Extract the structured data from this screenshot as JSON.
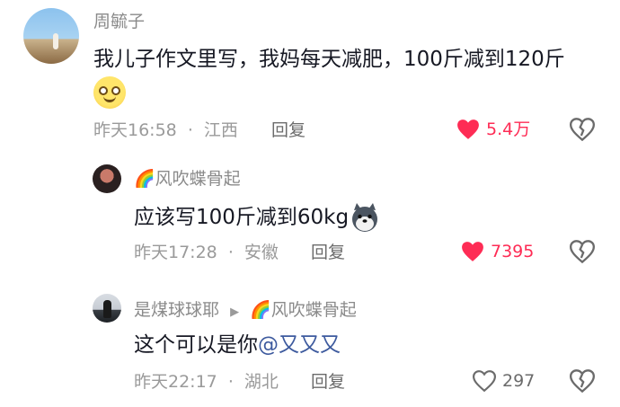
{
  "comments": [
    {
      "username": "周毓子",
      "text": "我儿子作文里写，我妈每天减肥，100斤减到120斤",
      "emoji": "blushing-smile-emoji",
      "time": "昨天16:58",
      "location": "江西",
      "reply_label": "回复",
      "likes": "5.4万",
      "liked": true
    },
    {
      "username_prefix": "🌈",
      "username": "风吹蝶骨起",
      "text": "应该写100斤减到60kg",
      "emoji": "husky-dog-emoji",
      "time": "昨天17:28",
      "location": "安徽",
      "reply_label": "回复",
      "likes": "7395",
      "liked": true
    },
    {
      "username": "是煤球球耶",
      "reply_to_prefix": "🌈",
      "reply_to": "风吹蝶骨起",
      "text": "这个可以是你",
      "mention": "@又又又",
      "time": "昨天22:17",
      "location": "湖北",
      "reply_label": "回复",
      "likes": "297",
      "liked": false
    }
  ],
  "separator": "·",
  "colors": {
    "like_active": "#fe2c55",
    "mention": "#3d5a9e",
    "meta": "#9a9a9a"
  }
}
